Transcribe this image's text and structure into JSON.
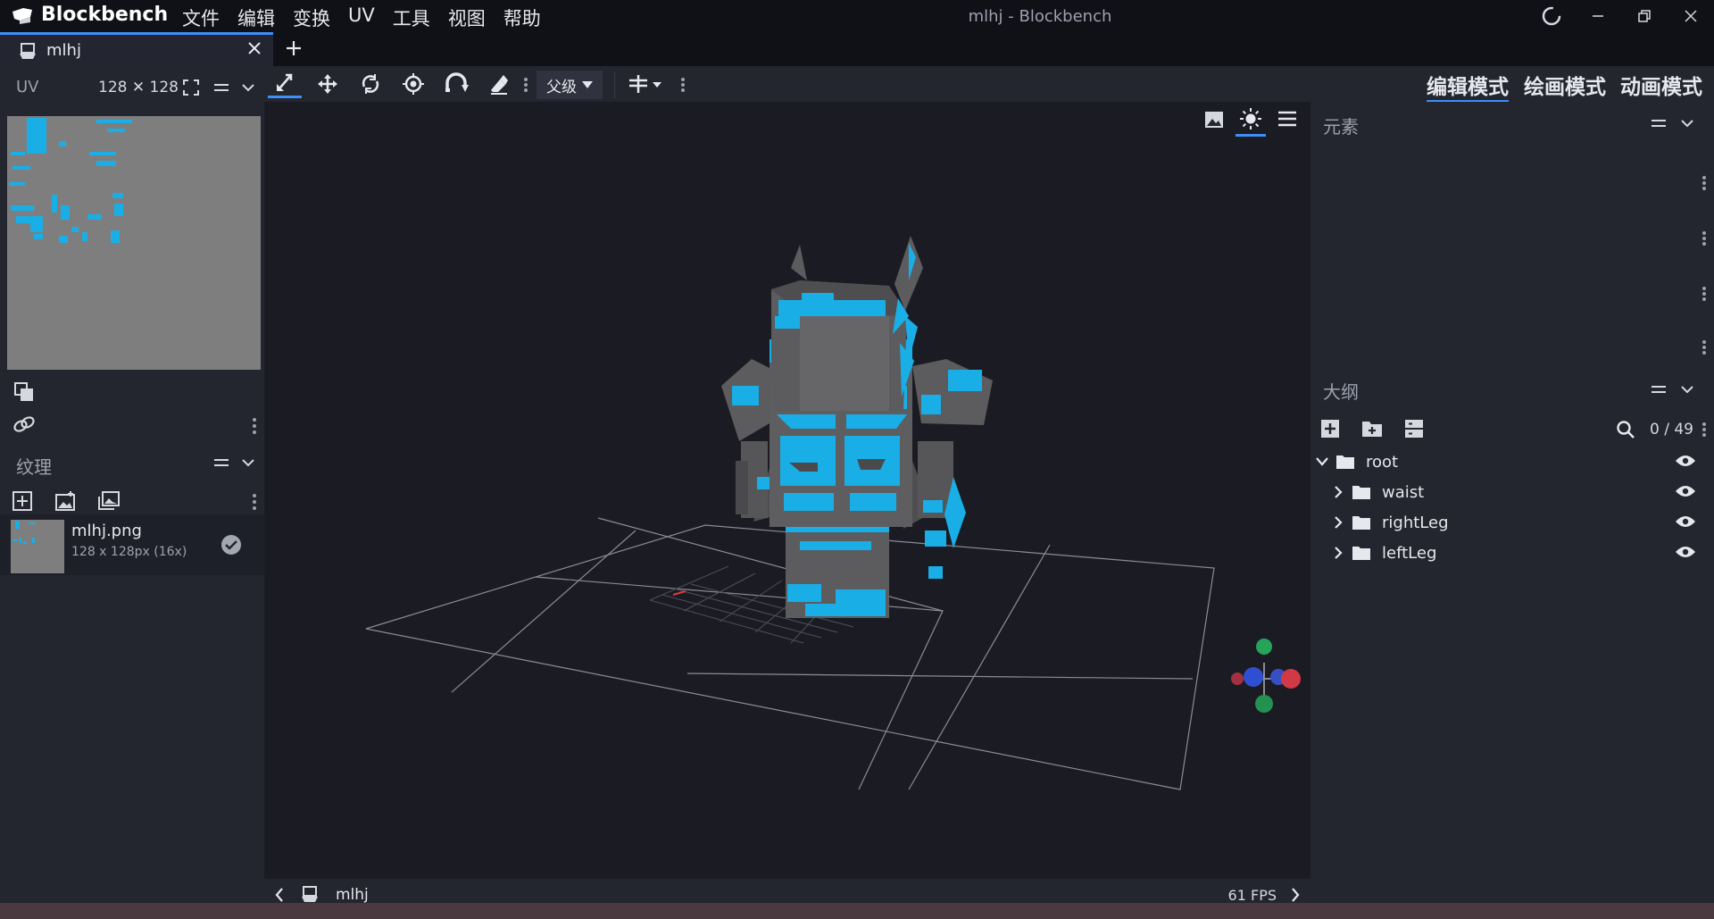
{
  "app": {
    "name": "Blockbench",
    "window_title": "mlhj - Blockbench"
  },
  "menu": [
    "文件",
    "编辑",
    "变换",
    "UV",
    "工具",
    "视图",
    "帮助"
  ],
  "tabs": [
    {
      "label": "mlhj"
    }
  ],
  "uv_panel": {
    "title": "UV",
    "size": "128 ✕ 128"
  },
  "texture_panel": {
    "title": "纹理",
    "items": [
      {
        "name": "mlhj.png",
        "info": "128 x 128px (16x)"
      }
    ]
  },
  "toolbar": {
    "pivot_label": "父级"
  },
  "modes": [
    {
      "label": "编辑模式",
      "active": true
    },
    {
      "label": "绘画模式",
      "active": false
    },
    {
      "label": "动画模式",
      "active": false
    }
  ],
  "element_panel": {
    "title": "元素"
  },
  "outliner": {
    "title": "大纲",
    "count": "0 / 49",
    "items": [
      {
        "name": "root",
        "expanded": true
      },
      {
        "name": "waist",
        "expanded": false
      },
      {
        "name": "rightLeg",
        "expanded": false
      },
      {
        "name": "leftLeg",
        "expanded": false
      }
    ]
  },
  "viewport": {
    "model_name": "mlhj",
    "fps": "61 FPS"
  },
  "colors": {
    "accent": "#3c8ef8",
    "armor": "#1aaee6",
    "body": "#5a5a5c"
  }
}
